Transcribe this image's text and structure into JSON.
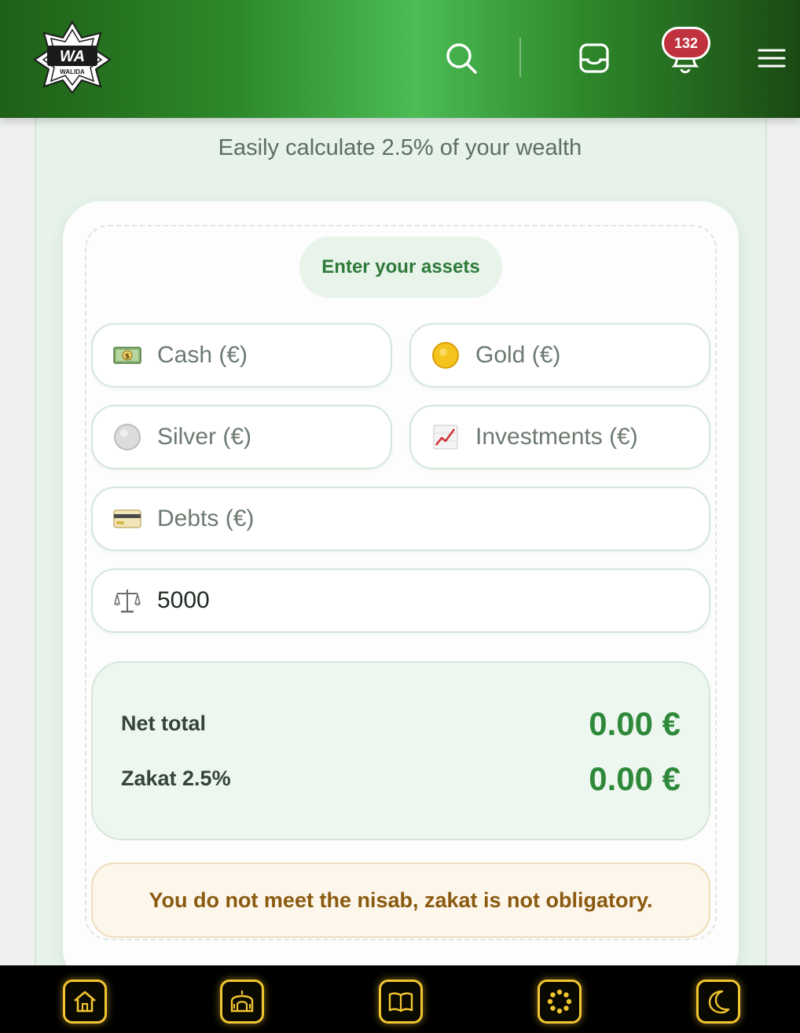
{
  "header": {
    "logo_text": "WA",
    "logo_subtext": "WALIDA",
    "notification_count": "132"
  },
  "subtitle": "Easily calculate 2.5% of your wealth",
  "section_pill": "Enter your assets",
  "fields": {
    "cash": {
      "label": "Cash (€)",
      "icon": "money-icon"
    },
    "gold": {
      "label": "Gold (€)",
      "icon": "gold-coin-icon"
    },
    "silver": {
      "label": "Silver (€)",
      "icon": "silver-coin-icon"
    },
    "investments": {
      "label": "Investments (€)",
      "icon": "chart-up-icon"
    },
    "debts": {
      "label": "Debts (€)",
      "icon": "credit-card-icon"
    },
    "nisab": {
      "value": "5000",
      "icon": "scales-icon"
    }
  },
  "results": {
    "net_total_label": "Net total",
    "net_total_value": "0.00 €",
    "zakat_label": "Zakat 2.5%",
    "zakat_value": "0.00 €"
  },
  "warning": "You do not meet the nisab, zakat is not obligatory.",
  "colors": {
    "brand_green": "#2e8a3a",
    "header_green": "#4cbc55",
    "badge_red": "#c0323e",
    "nav_gold": "#f2c531",
    "warning_text": "#8a5a10"
  },
  "bottom_nav": [
    "home-icon",
    "mosque-icon",
    "book-icon",
    "prayer-beads-icon",
    "crescent-moon-icon"
  ]
}
